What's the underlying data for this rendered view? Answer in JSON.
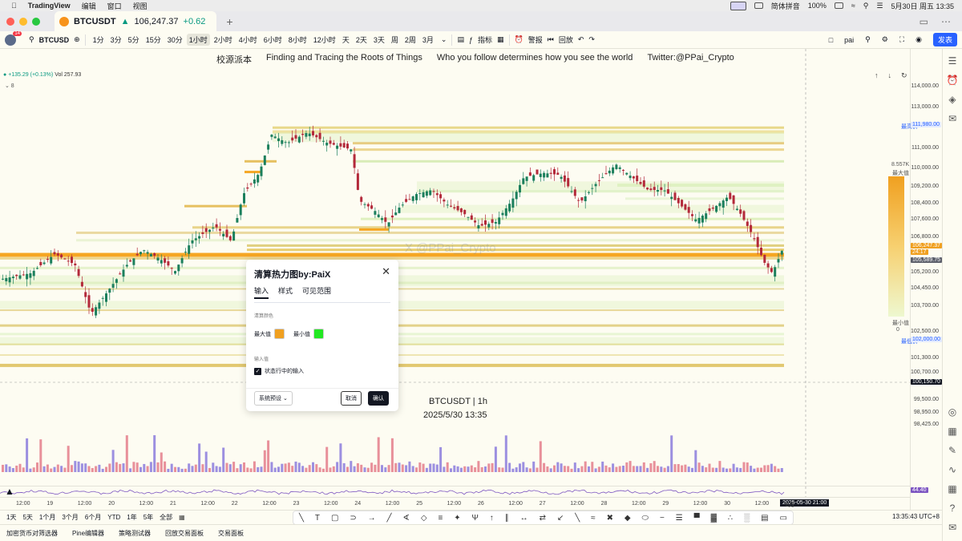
{
  "mac": {
    "app": "TradingView",
    "menus": [
      "编辑",
      "窗口",
      "视图"
    ],
    "ime": "简体拼音",
    "battery": "100%",
    "datetime": "5月30日 周五 13:35"
  },
  "tab": {
    "symbol": "BTCUSDT",
    "price": "106,247.37",
    "change": "+0.62"
  },
  "toolbar": {
    "notif_count": "14",
    "symbol": "BTCUSD",
    "intervals": [
      "1分",
      "3分",
      "5分",
      "15分",
      "30分",
      "1小时",
      "2小时",
      "4小时",
      "6小时",
      "8小时",
      "12小时",
      "天",
      "2天",
      "3天",
      "周",
      "2周",
      "3月"
    ],
    "active_interval": "1小时",
    "indicators": "指标",
    "alerts": "警报",
    "replay": "回放",
    "account": "pai",
    "publish": "发表"
  },
  "banner": [
    "校源派本",
    "Finding and Tracing the Roots of Things",
    "Who you follow determines how you see the world",
    "Twitter:@PPai_Crypto"
  ],
  "ohlc": {
    "change": "+135.29 (+0.13%)",
    "vol": "Vol 257.93"
  },
  "watermark": "X @PPai_Crypto",
  "chart_label": {
    "pair": "BTCUSDT | 1h",
    "datetime": "2025/5/30 13:35"
  },
  "price_scale": {
    "labels": [
      "114,000.00",
      "113,000.00",
      "111,000.00",
      "110,000.00",
      "109,200.00",
      "108,400.00",
      "107,600.00",
      "106,800.00",
      "105,200.00",
      "104,450.00",
      "103,700.00",
      "102,500.00",
      "101,300.00",
      "100,700.00",
      "99,500.00",
      "98,950.00",
      "98,425.00"
    ],
    "highest_label": "最高价",
    "highest_value": "111,980.00",
    "lowest_label": "最低价",
    "lowest_value": "102,000.00",
    "current_price": "106,247.37",
    "countdown": "24:17",
    "level_price": "105,589.75",
    "cross_price": "100,150.70",
    "heat_top_value": "8.557K",
    "heat_top_label": "最大值",
    "heat_bottom_label": "最小值",
    "heat_bottom_value": "0",
    "ind_value1": "",
    "ind_value2": "44.40"
  },
  "time_axis": [
    "12:00",
    "19",
    "12:00",
    "20",
    "12:00",
    "21",
    "12:00",
    "22",
    "12:00",
    "23",
    "12:00",
    "24",
    "12:00",
    "25",
    "12:00",
    "26",
    "12:00",
    "27",
    "12:00",
    "28",
    "12:00",
    "29",
    "12:00",
    "30",
    "12:00",
    "6月"
  ],
  "cross_time": "2025-05-30  21:00",
  "dialog": {
    "title": "清算热力图by:PaiX",
    "tabs": [
      "输入",
      "样式",
      "可见范围"
    ],
    "section1": "清算颜色",
    "max_label": "最大值",
    "max_color": "#f0a020",
    "min_label": "最小值",
    "min_color": "#22e822",
    "section2": "输入值",
    "checkbox_label": "状态行中的输入",
    "preset": "系统预设",
    "cancel": "取消",
    "ok": "确认"
  },
  "ranges": [
    "1天",
    "5天",
    "1个月",
    "3个月",
    "6个月",
    "YTD",
    "1年",
    "5年",
    "全部"
  ],
  "clock": "13:35:43 UTC+8",
  "panels": [
    "加密货币对筛选器",
    "Pine编辑器",
    "策略测试器",
    "回放交易面板",
    "交易面板"
  ]
}
